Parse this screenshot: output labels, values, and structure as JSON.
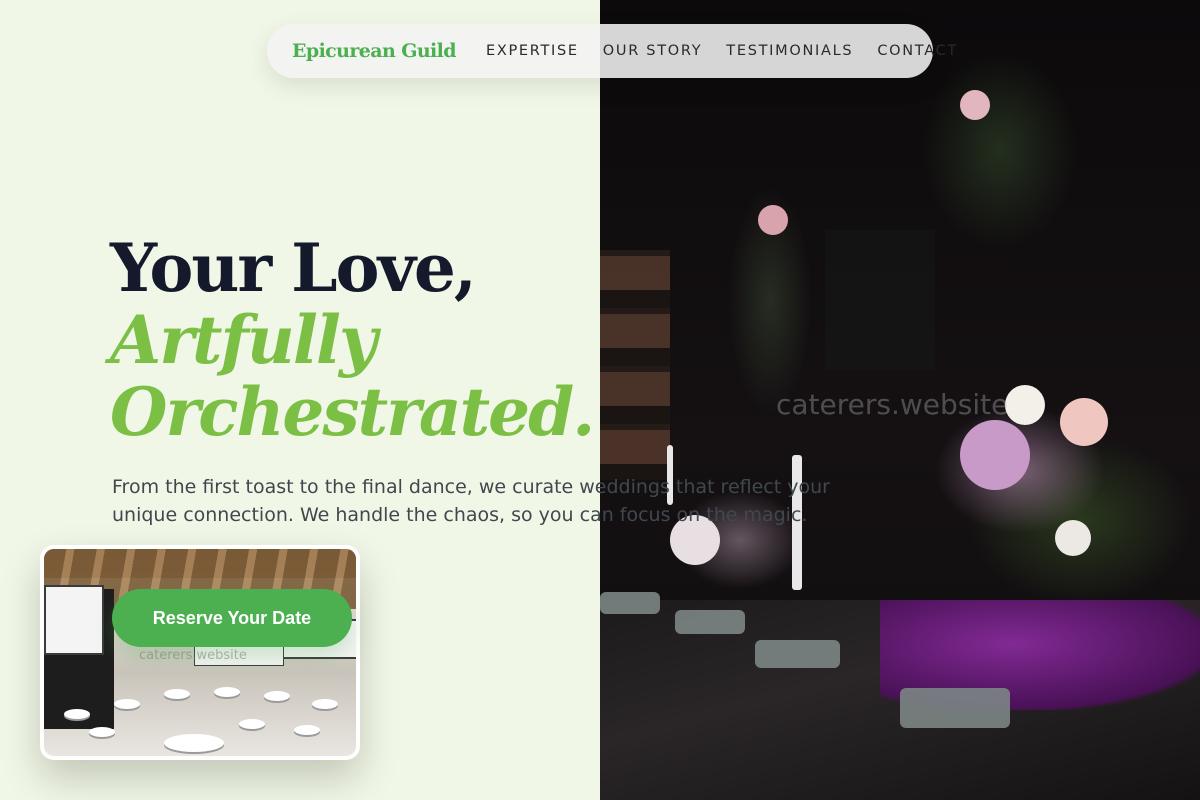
{
  "brand": {
    "name": "Epicurean Guild"
  },
  "nav": {
    "links": [
      {
        "label": "EXPERTISE"
      },
      {
        "label": "OUR STORY"
      },
      {
        "label": "TESTIMONIALS"
      },
      {
        "label": "CONTACT"
      }
    ]
  },
  "hero": {
    "title_line1": "Your Love,",
    "title_line2": "Artfully",
    "title_line3": "Orchestrated.",
    "description": "From the first toast to the final dance, we curate weddings that reflect your unique connection. We handle the chaos, so you can focus on the magic.",
    "cta_label": "Reserve Your Date"
  },
  "photo": {
    "watermark": "caterers.website"
  },
  "venue_card": {
    "watermark": "caterers.website"
  },
  "colors": {
    "accent": "#4caf50",
    "accent_light": "#7cbf45",
    "heading": "#141a2c",
    "background": "#f1f7e6"
  }
}
